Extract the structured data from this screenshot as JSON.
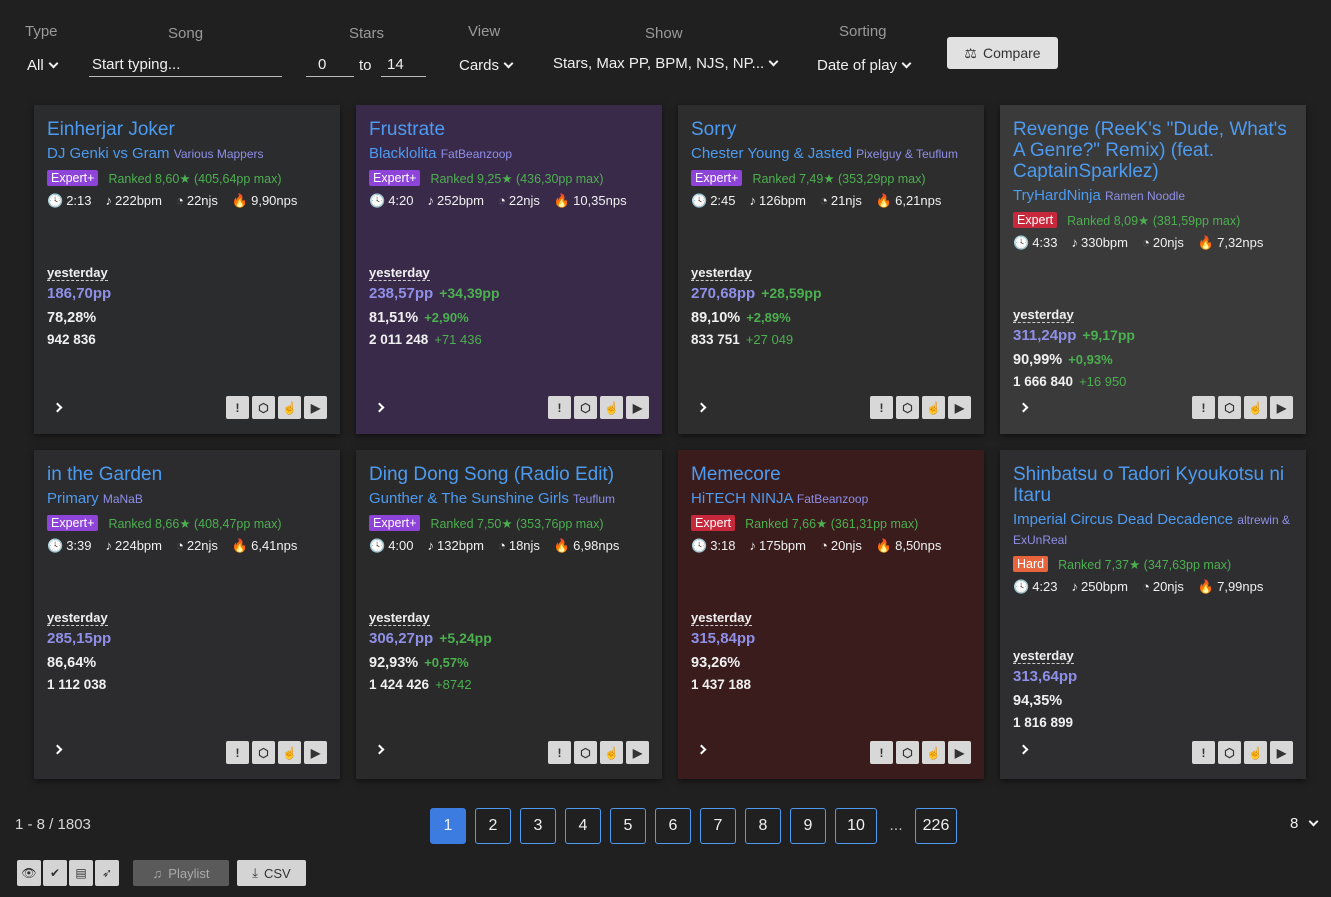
{
  "filters": {
    "type_label": "Type",
    "type_value": "All",
    "song_label": "Song",
    "song_placeholder": "Start typing...",
    "stars_label": "Stars",
    "stars_from": "0",
    "stars_to_label": "to",
    "stars_to": "14",
    "view_label": "View",
    "view_value": "Cards",
    "show_label": "Show",
    "show_value": "Stars, Max PP, BPM, NJS, NP...",
    "sorting_label": "Sorting",
    "sorting_value": "Date of play",
    "compare_label": "Compare"
  },
  "cards": [
    {
      "title": "Einherjar Joker",
      "artist": "DJ Genki vs Gram",
      "mapper": "Various Mappers",
      "diff": "Expert+",
      "ranked": "Ranked 8,60★ (405,64pp max)",
      "duration": "2:13",
      "bpm": "222bpm",
      "njs": "22njs",
      "nps": "9,90nps",
      "when": "yesterday",
      "pp": "186,70pp",
      "pp_delta": "",
      "acc": "78,28%",
      "acc_delta": "",
      "score": "942 836",
      "score_delta": ""
    },
    {
      "title": "Frustrate",
      "artist": "Blacklolita",
      "mapper": "FatBeanzoop",
      "diff": "Expert+",
      "ranked": "Ranked 9,25★ (436,30pp max)",
      "duration": "4:20",
      "bpm": "252bpm",
      "njs": "22njs",
      "nps": "10,35nps",
      "when": "yesterday",
      "pp": "238,57pp",
      "pp_delta": "+34,39pp",
      "acc": "81,51%",
      "acc_delta": "+2,90%",
      "score": "2 011 248",
      "score_delta": "+71 436"
    },
    {
      "title": "Sorry",
      "artist": "Chester Young & Jasted",
      "mapper": "Pixelguy & Teuflum",
      "diff": "Expert+",
      "ranked": "Ranked 7,49★ (353,29pp max)",
      "duration": "2:45",
      "bpm": "126bpm",
      "njs": "21njs",
      "nps": "6,21nps",
      "when": "yesterday",
      "pp": "270,68pp",
      "pp_delta": "+28,59pp",
      "acc": "89,10%",
      "acc_delta": "+2,89%",
      "score": "833 751",
      "score_delta": "+27 049"
    },
    {
      "title": "Revenge (ReeK's \"Dude, What's A Genre?\" Remix) (feat. CaptainSparklez)",
      "artist": "TryHardNinja",
      "mapper": "Ramen Noodle",
      "diff": "Expert",
      "ranked": "Ranked 8,09★ (381,59pp max)",
      "duration": "4:33",
      "bpm": "330bpm",
      "njs": "20njs",
      "nps": "7,32nps",
      "when": "yesterday",
      "pp": "311,24pp",
      "pp_delta": "+9,17pp",
      "acc": "90,99%",
      "acc_delta": "+0,93%",
      "score": "1 666 840",
      "score_delta": "+16 950"
    },
    {
      "title": "in the Garden",
      "artist": "Primary",
      "mapper": "MaNaB",
      "diff": "Expert+",
      "ranked": "Ranked 8,66★ (408,47pp max)",
      "duration": "3:39",
      "bpm": "224bpm",
      "njs": "22njs",
      "nps": "6,41nps",
      "when": "yesterday",
      "pp": "285,15pp",
      "pp_delta": "",
      "acc": "86,64%",
      "acc_delta": "",
      "score": "1 112 038",
      "score_delta": ""
    },
    {
      "title": "Ding Dong Song (Radio Edit)",
      "artist": "Gunther & The Sunshine Girls",
      "mapper": "Teuflum",
      "diff": "Expert+",
      "ranked": "Ranked 7,50★ (353,76pp max)",
      "duration": "4:00",
      "bpm": "132bpm",
      "njs": "18njs",
      "nps": "6,98nps",
      "when": "yesterday",
      "pp": "306,27pp",
      "pp_delta": "+5,24pp",
      "acc": "92,93%",
      "acc_delta": "+0,57%",
      "score": "1 424 426",
      "score_delta": "+8742"
    },
    {
      "title": "Memecore",
      "artist": "HiTECH NINJA",
      "mapper": "FatBeanzoop",
      "diff": "Expert",
      "ranked": "Ranked 7,66★ (361,31pp max)",
      "duration": "3:18",
      "bpm": "175bpm",
      "njs": "20njs",
      "nps": "8,50nps",
      "when": "yesterday",
      "pp": "315,84pp",
      "pp_delta": "",
      "acc": "93,26%",
      "acc_delta": "",
      "score": "1 437 188",
      "score_delta": ""
    },
    {
      "title": "Shinbatsu o Tadori Kyoukotsu ni Itaru",
      "artist": "Imperial Circus Dead Decadence",
      "mapper": "altrewin & ExUnReal",
      "diff": "Hard",
      "ranked": "Ranked 7,37★ (347,63pp max)",
      "duration": "4:23",
      "bpm": "250bpm",
      "njs": "20njs",
      "nps": "7,99nps",
      "when": "yesterday",
      "pp": "313,64pp",
      "pp_delta": "",
      "acc": "94,35%",
      "acc_delta": "",
      "score": "1 816 899",
      "score_delta": ""
    }
  ],
  "colors": {
    "expert_plus": "#8e44d8",
    "expert": "#c8283c",
    "hard": "#e8643c",
    "accent": "#4d9bf0",
    "pp": "#8f8fe8",
    "positive": "#4caf50"
  },
  "pagination": {
    "range": "1 - 8 / 1803",
    "pages": [
      "1",
      "2",
      "3",
      "4",
      "5",
      "6",
      "7",
      "8",
      "9",
      "10"
    ],
    "ellipsis": "...",
    "last": "226",
    "per_page": "8"
  },
  "bottom": {
    "playlist_label": "Playlist",
    "csv_label": "CSV"
  }
}
